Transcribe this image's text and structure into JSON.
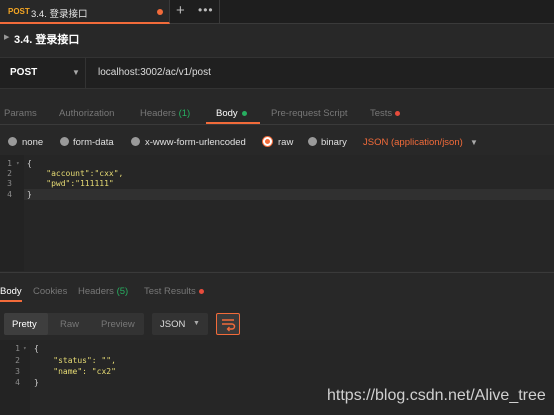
{
  "tab": {
    "method": "POST",
    "title": "3.4. 登录接口",
    "new_tab_symbol": "+",
    "more_symbol": "•••"
  },
  "request": {
    "name": "3.4. 登录接口",
    "method": "POST",
    "url": "localhost:3002/ac/v1/post"
  },
  "request_tabs": {
    "params": "Params",
    "authorization": "Authorization",
    "headers": "Headers",
    "headers_count": "(1)",
    "body": "Body",
    "prerequest": "Pre-request Script",
    "tests": "Tests"
  },
  "body_types": {
    "none": "none",
    "form_data": "form-data",
    "urlencoded": "x-www-form-urlencoded",
    "raw": "raw",
    "binary": "binary",
    "content_type": "JSON (application/json)"
  },
  "request_body": {
    "line_numbers": [
      "1",
      "2",
      "3",
      "4"
    ],
    "lines": [
      {
        "pre": "{",
        "str": "",
        "post": ""
      },
      {
        "pre": "    ",
        "str": "\"account\"",
        "post": ":\"cxx\","
      },
      {
        "pre": "    ",
        "str": "\"pwd\"",
        "post": ":\"111111\""
      },
      {
        "pre": "}",
        "str": "",
        "post": ""
      }
    ]
  },
  "response_tabs": {
    "body": "Body",
    "cookies": "Cookies",
    "headers": "Headers",
    "headers_count": "(5)",
    "test_results": "Test Results"
  },
  "response_format": {
    "pretty": "Pretty",
    "raw": "Raw",
    "preview": "Preview",
    "language": "JSON"
  },
  "response_body": {
    "line_numbers": [
      "1",
      "2",
      "3",
      "4"
    ],
    "lines": [
      {
        "pre": "{",
        "str": "",
        "post": ""
      },
      {
        "pre": "    ",
        "str": "\"status\"",
        "post": ": \"\","
      },
      {
        "pre": "    ",
        "str": "\"name\"",
        "post": ": \"cx2\""
      },
      {
        "pre": "}",
        "str": "",
        "post": ""
      }
    ]
  },
  "watermark": "https://blog.csdn.net/Alive_tree",
  "colors": {
    "accent": "#f26b3a",
    "string": "#e6db74",
    "count_green": "#27ae60",
    "error_red": "#e74c3c"
  }
}
